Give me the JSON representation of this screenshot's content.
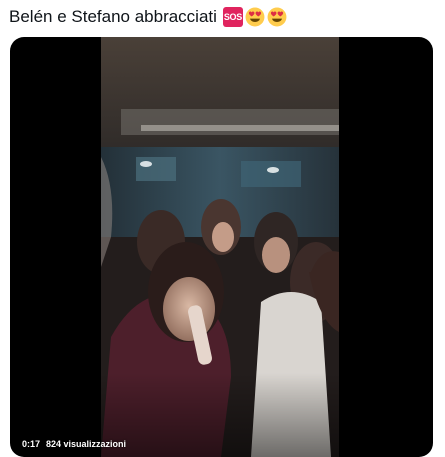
{
  "tweet": {
    "text": "Belén e Stefano abbracciati",
    "emojis": [
      "sos-emoji",
      "heart-eyes-emoji",
      "heart-eyes-emoji"
    ],
    "sos_label": "SOS"
  },
  "video": {
    "elapsed_time": "0:17",
    "views": "824 visualizzazioni"
  },
  "colors": {
    "background": "#ffffff",
    "text": "#0f1419",
    "media_bg": "#000000",
    "sos_red": "#e0245e",
    "emoji_yellow": "#ffcc4d",
    "heart_red": "#dd2e44"
  }
}
